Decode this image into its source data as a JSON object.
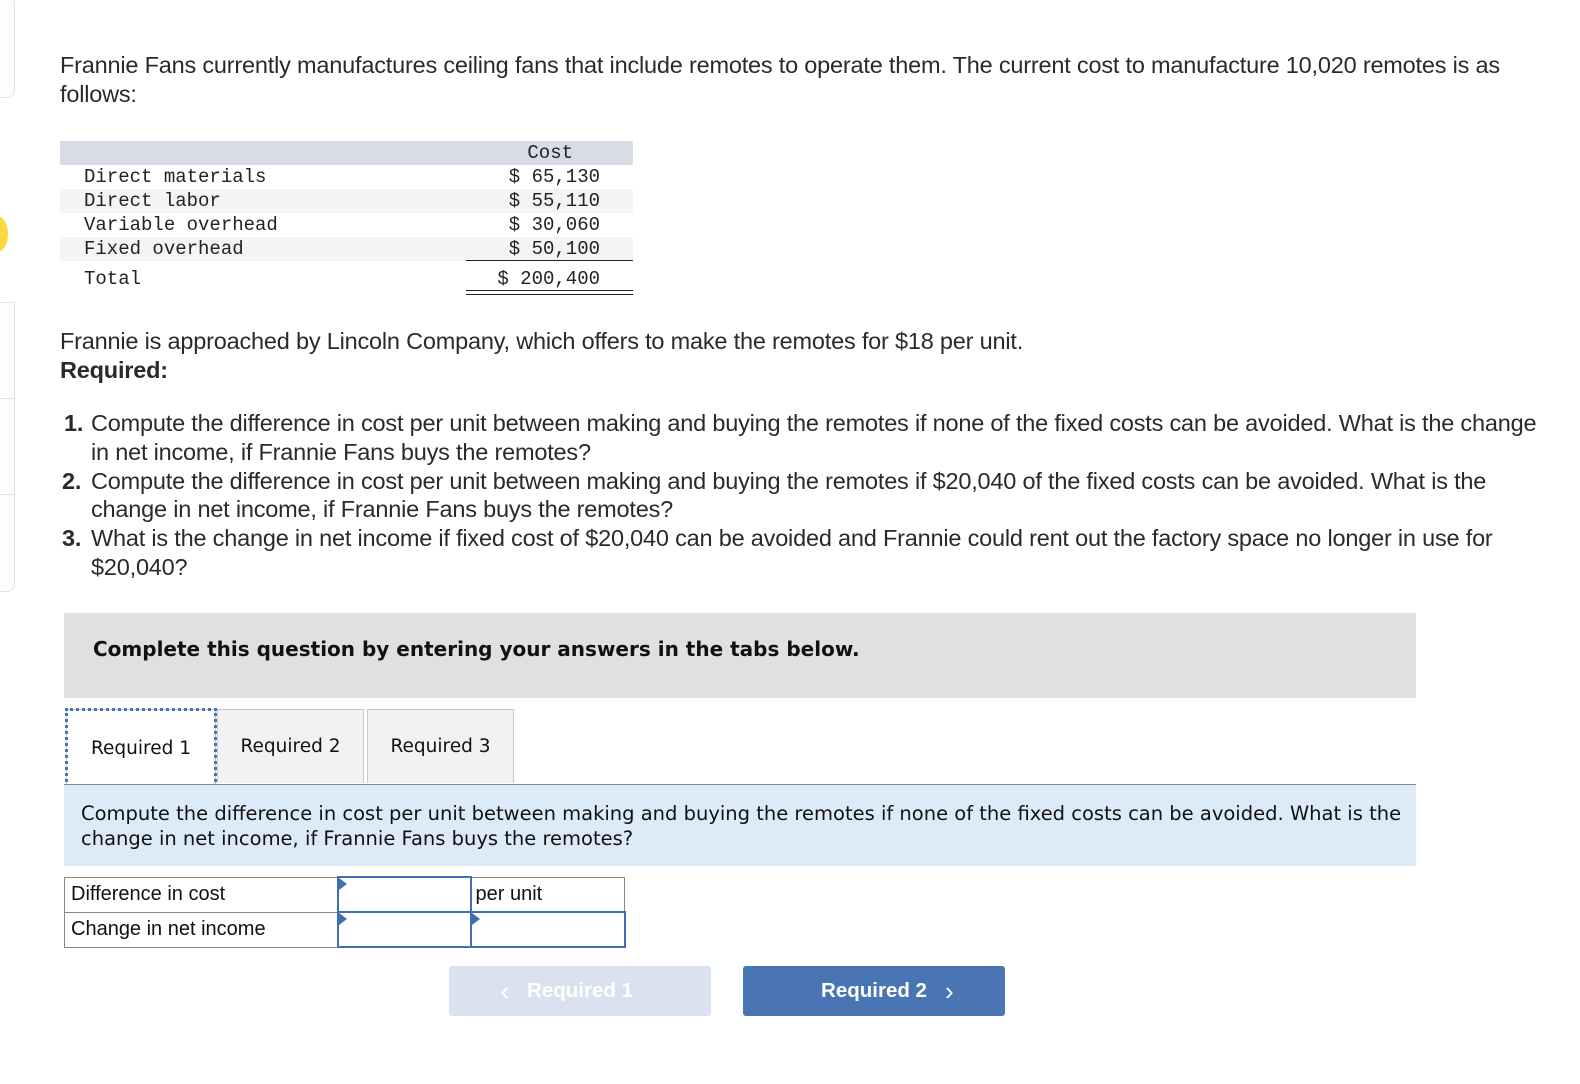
{
  "intro_text": "Frannie Fans currently manufactures ceiling fans that include remotes to operate them. The current cost to manufacture 10,020 remotes is as follows:",
  "cost_table": {
    "header": "Cost",
    "rows": [
      {
        "label": "Direct materials",
        "value": "$ 65,130"
      },
      {
        "label": "Direct labor",
        "value": "$ 55,110"
      },
      {
        "label": "Variable overhead",
        "value": "$ 30,060"
      },
      {
        "label": "Fixed overhead",
        "value": "$ 50,100"
      }
    ],
    "total": {
      "label": "Total",
      "value": "$ 200,400"
    }
  },
  "offer_text": "Frannie is approached by Lincoln Company, which offers to make the remotes for $18 per unit.",
  "required_label": "Required:",
  "requirements": [
    {
      "num": "1.",
      "text": "Compute the difference in cost per unit between making and buying the remotes if none of the fixed costs can be avoided. What is the change in net income, if Frannie Fans buys the remotes?"
    },
    {
      "num": "2.",
      "text": "Compute the difference in cost per unit between making and buying the remotes if $20,040 of the fixed costs can be avoided. What is the change in net income, if Frannie Fans buys the remotes?"
    },
    {
      "num": "3.",
      "text": "What is the change in net income if fixed cost of $20,040 can be avoided and Frannie could rent out the factory space no longer in use for $20,040?"
    }
  ],
  "instruction": "Complete this question by entering your answers in the tabs below.",
  "tabs": [
    {
      "label": "Required 1",
      "active": true
    },
    {
      "label": "Required 2",
      "active": false
    },
    {
      "label": "Required 3",
      "active": false
    }
  ],
  "prompt": "Compute the difference in cost per unit between making and buying the remotes if none of the fixed costs can be avoided. What is the change in net income, if Frannie Fans buys the remotes?",
  "answer_rows": [
    {
      "label": "Difference in cost",
      "value": "",
      "unit": "per unit"
    },
    {
      "label": "Change in net income",
      "value": "",
      "unit_value": ""
    }
  ],
  "nav": {
    "prev_label": "Required 1",
    "next_label": "Required 2",
    "prev_icon": "chevron-left-icon",
    "next_icon": "chevron-right-icon"
  },
  "colors": {
    "accent": "#4a75b5",
    "disabled_button": "#d9e2ee",
    "prompt_bg": "#ddeaf7",
    "instruction_bg": "#e0e0e0",
    "edge_dot": "#fcd940"
  }
}
